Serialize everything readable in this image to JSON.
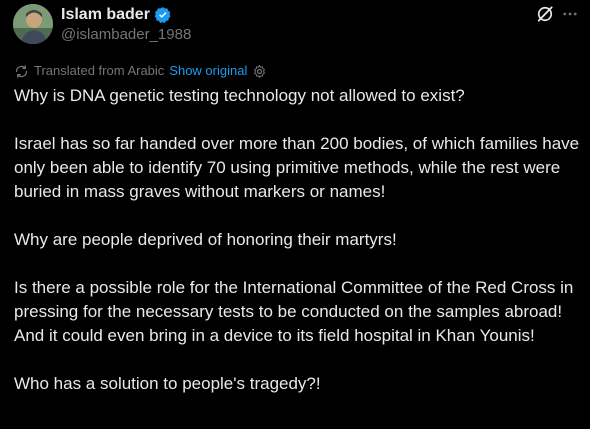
{
  "author": {
    "display_name": "Islam bader",
    "handle": "@islambader_1988",
    "verified_color": "#1d9bf0"
  },
  "actions": {
    "grok_icon": "grok-icon",
    "more_icon": "more-horizontal-icon"
  },
  "translation": {
    "label": "Translated from Arabic",
    "show_original": "Show original",
    "icon": "translate-icon",
    "settings_icon": "gear-icon"
  },
  "post": {
    "paragraphs": [
      "Why is DNA genetic testing technology not allowed to exist?",
      "Israel has so far handed over more than 200 bodies, of which families have only been able to identify 70 using primitive methods, while the rest were buried in mass graves without markers or names!",
      "Why are people deprived of honoring their martyrs!",
      "Is there a possible role for the International Committee of the Red Cross in pressing for the necessary tests to be conducted on the samples abroad! And it could even bring in a device to its field hospital in Khan Younis!",
      "Who has a solution to people's tragedy?!"
    ]
  },
  "colors": {
    "background": "#000000",
    "text": "#e7e9ea",
    "secondary": "#71767b",
    "accent": "#1d9bf0"
  }
}
